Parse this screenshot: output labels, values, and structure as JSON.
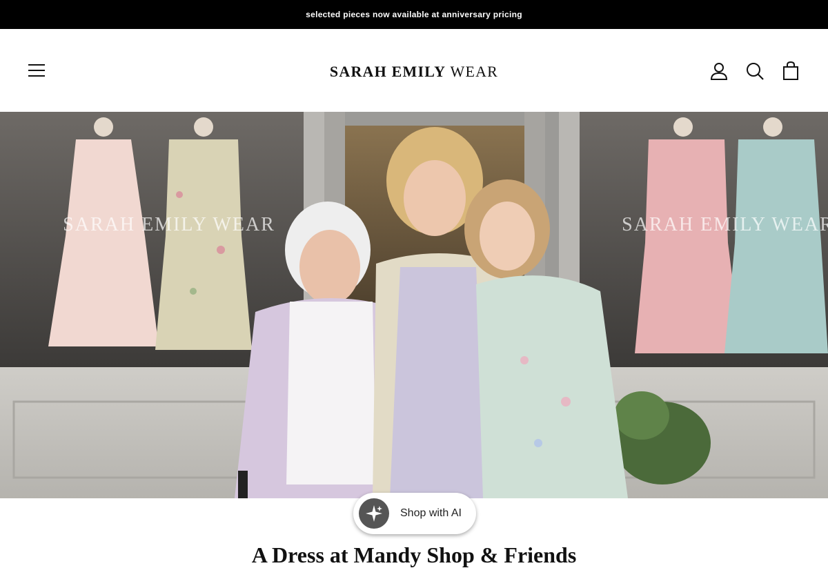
{
  "announcement": {
    "text": "selected pieces now available at anniversary pricing"
  },
  "header": {
    "logo_main": "SARAH EMILY",
    "logo_sub": " WEAR",
    "icons": [
      "menu-icon",
      "account-icon",
      "search-icon",
      "cart-icon"
    ]
  },
  "hero": {
    "window_text_left": "SARAH EMILY WEAR",
    "window_text_right": "SARAH EMILY WEAR"
  },
  "ai_widget": {
    "label": "Shop with AI",
    "icon": "sparkle-icon"
  },
  "section": {
    "title": "A Dress at Mandy Shop & Friends"
  },
  "colors": {
    "announce_bg": "#000000",
    "text": "#111111",
    "ai_icon_bg": "#555555"
  }
}
